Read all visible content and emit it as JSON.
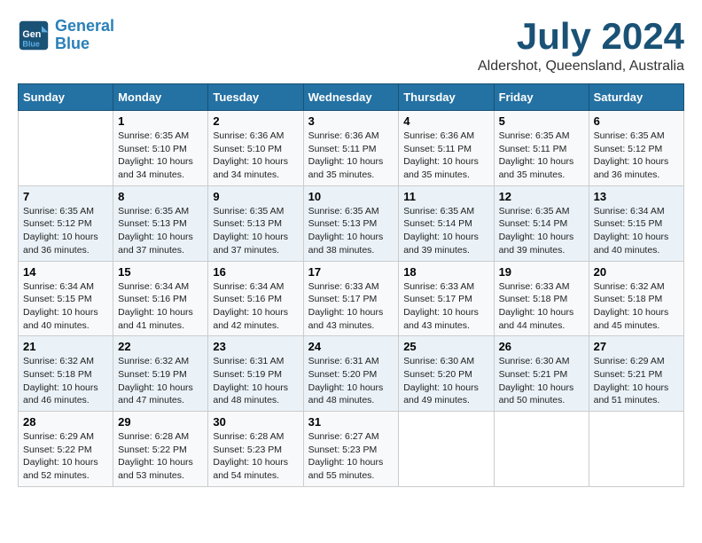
{
  "header": {
    "logo_line1": "General",
    "logo_line2": "Blue",
    "month": "July 2024",
    "location": "Aldershot, Queensland, Australia"
  },
  "columns": [
    "Sunday",
    "Monday",
    "Tuesday",
    "Wednesday",
    "Thursday",
    "Friday",
    "Saturday"
  ],
  "weeks": [
    [
      {
        "day": "",
        "content": ""
      },
      {
        "day": "1",
        "content": "Sunrise: 6:35 AM\nSunset: 5:10 PM\nDaylight: 10 hours\nand 34 minutes."
      },
      {
        "day": "2",
        "content": "Sunrise: 6:36 AM\nSunset: 5:10 PM\nDaylight: 10 hours\nand 34 minutes."
      },
      {
        "day": "3",
        "content": "Sunrise: 6:36 AM\nSunset: 5:11 PM\nDaylight: 10 hours\nand 35 minutes."
      },
      {
        "day": "4",
        "content": "Sunrise: 6:36 AM\nSunset: 5:11 PM\nDaylight: 10 hours\nand 35 minutes."
      },
      {
        "day": "5",
        "content": "Sunrise: 6:35 AM\nSunset: 5:11 PM\nDaylight: 10 hours\nand 35 minutes."
      },
      {
        "day": "6",
        "content": "Sunrise: 6:35 AM\nSunset: 5:12 PM\nDaylight: 10 hours\nand 36 minutes."
      }
    ],
    [
      {
        "day": "7",
        "content": "Sunrise: 6:35 AM\nSunset: 5:12 PM\nDaylight: 10 hours\nand 36 minutes."
      },
      {
        "day": "8",
        "content": "Sunrise: 6:35 AM\nSunset: 5:13 PM\nDaylight: 10 hours\nand 37 minutes."
      },
      {
        "day": "9",
        "content": "Sunrise: 6:35 AM\nSunset: 5:13 PM\nDaylight: 10 hours\nand 37 minutes."
      },
      {
        "day": "10",
        "content": "Sunrise: 6:35 AM\nSunset: 5:13 PM\nDaylight: 10 hours\nand 38 minutes."
      },
      {
        "day": "11",
        "content": "Sunrise: 6:35 AM\nSunset: 5:14 PM\nDaylight: 10 hours\nand 39 minutes."
      },
      {
        "day": "12",
        "content": "Sunrise: 6:35 AM\nSunset: 5:14 PM\nDaylight: 10 hours\nand 39 minutes."
      },
      {
        "day": "13",
        "content": "Sunrise: 6:34 AM\nSunset: 5:15 PM\nDaylight: 10 hours\nand 40 minutes."
      }
    ],
    [
      {
        "day": "14",
        "content": "Sunrise: 6:34 AM\nSunset: 5:15 PM\nDaylight: 10 hours\nand 40 minutes."
      },
      {
        "day": "15",
        "content": "Sunrise: 6:34 AM\nSunset: 5:16 PM\nDaylight: 10 hours\nand 41 minutes."
      },
      {
        "day": "16",
        "content": "Sunrise: 6:34 AM\nSunset: 5:16 PM\nDaylight: 10 hours\nand 42 minutes."
      },
      {
        "day": "17",
        "content": "Sunrise: 6:33 AM\nSunset: 5:17 PM\nDaylight: 10 hours\nand 43 minutes."
      },
      {
        "day": "18",
        "content": "Sunrise: 6:33 AM\nSunset: 5:17 PM\nDaylight: 10 hours\nand 43 minutes."
      },
      {
        "day": "19",
        "content": "Sunrise: 6:33 AM\nSunset: 5:18 PM\nDaylight: 10 hours\nand 44 minutes."
      },
      {
        "day": "20",
        "content": "Sunrise: 6:32 AM\nSunset: 5:18 PM\nDaylight: 10 hours\nand 45 minutes."
      }
    ],
    [
      {
        "day": "21",
        "content": "Sunrise: 6:32 AM\nSunset: 5:18 PM\nDaylight: 10 hours\nand 46 minutes."
      },
      {
        "day": "22",
        "content": "Sunrise: 6:32 AM\nSunset: 5:19 PM\nDaylight: 10 hours\nand 47 minutes."
      },
      {
        "day": "23",
        "content": "Sunrise: 6:31 AM\nSunset: 5:19 PM\nDaylight: 10 hours\nand 48 minutes."
      },
      {
        "day": "24",
        "content": "Sunrise: 6:31 AM\nSunset: 5:20 PM\nDaylight: 10 hours\nand 48 minutes."
      },
      {
        "day": "25",
        "content": "Sunrise: 6:30 AM\nSunset: 5:20 PM\nDaylight: 10 hours\nand 49 minutes."
      },
      {
        "day": "26",
        "content": "Sunrise: 6:30 AM\nSunset: 5:21 PM\nDaylight: 10 hours\nand 50 minutes."
      },
      {
        "day": "27",
        "content": "Sunrise: 6:29 AM\nSunset: 5:21 PM\nDaylight: 10 hours\nand 51 minutes."
      }
    ],
    [
      {
        "day": "28",
        "content": "Sunrise: 6:29 AM\nSunset: 5:22 PM\nDaylight: 10 hours\nand 52 minutes."
      },
      {
        "day": "29",
        "content": "Sunrise: 6:28 AM\nSunset: 5:22 PM\nDaylight: 10 hours\nand 53 minutes."
      },
      {
        "day": "30",
        "content": "Sunrise: 6:28 AM\nSunset: 5:23 PM\nDaylight: 10 hours\nand 54 minutes."
      },
      {
        "day": "31",
        "content": "Sunrise: 6:27 AM\nSunset: 5:23 PM\nDaylight: 10 hours\nand 55 minutes."
      },
      {
        "day": "",
        "content": ""
      },
      {
        "day": "",
        "content": ""
      },
      {
        "day": "",
        "content": ""
      }
    ]
  ]
}
